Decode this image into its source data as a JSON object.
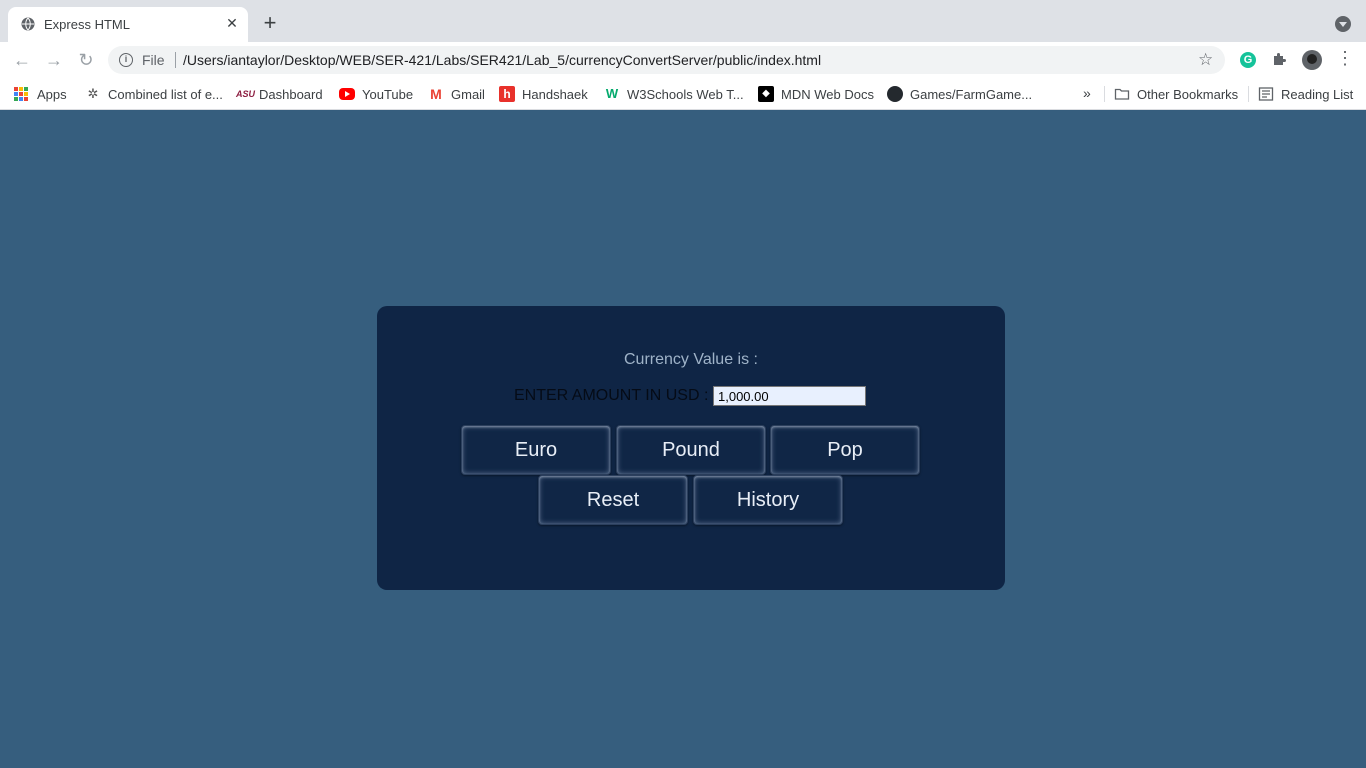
{
  "browser": {
    "tab": {
      "title": "Express HTML",
      "close": "✕"
    },
    "new_tab": "+",
    "address": {
      "scheme": "File",
      "url": "/Users/iantaylor/Desktop/WEB/SER-421/Labs/SER421/Lab_5/currencyConvertServer/public/index.html"
    },
    "bookmarks": [
      {
        "label": "Apps",
        "icon": "apps-grid-icon"
      },
      {
        "label": "Combined list of e...",
        "icon": "leaf-icon"
      },
      {
        "label": "Dashboard",
        "icon": "asu-icon"
      },
      {
        "label": "YouTube",
        "icon": "youtube-icon"
      },
      {
        "label": "Gmail",
        "icon": "gmail-icon"
      },
      {
        "label": "Handshaek",
        "icon": "handshake-icon"
      },
      {
        "label": "W3Schools Web T...",
        "icon": "w3schools-icon"
      },
      {
        "label": "MDN Web Docs",
        "icon": "mdn-icon"
      },
      {
        "label": "Games/FarmGame...",
        "icon": "github-icon"
      }
    ],
    "more_bookmarks": "»",
    "other_bookmarks": "Other Bookmarks",
    "reading_list": "Reading List"
  },
  "app": {
    "currency_label": "Currency Value is :",
    "amount_label": "ENTER AMOUNT IN USD :",
    "amount_value": "1,000.00",
    "buttons": {
      "euro": "Euro",
      "pound": "Pound",
      "pop": "Pop",
      "reset": "Reset",
      "history": "History"
    }
  },
  "colors": {
    "page_background": "#365e7e",
    "panel_background": "#0f2545",
    "button_text": "#e8eef7"
  }
}
